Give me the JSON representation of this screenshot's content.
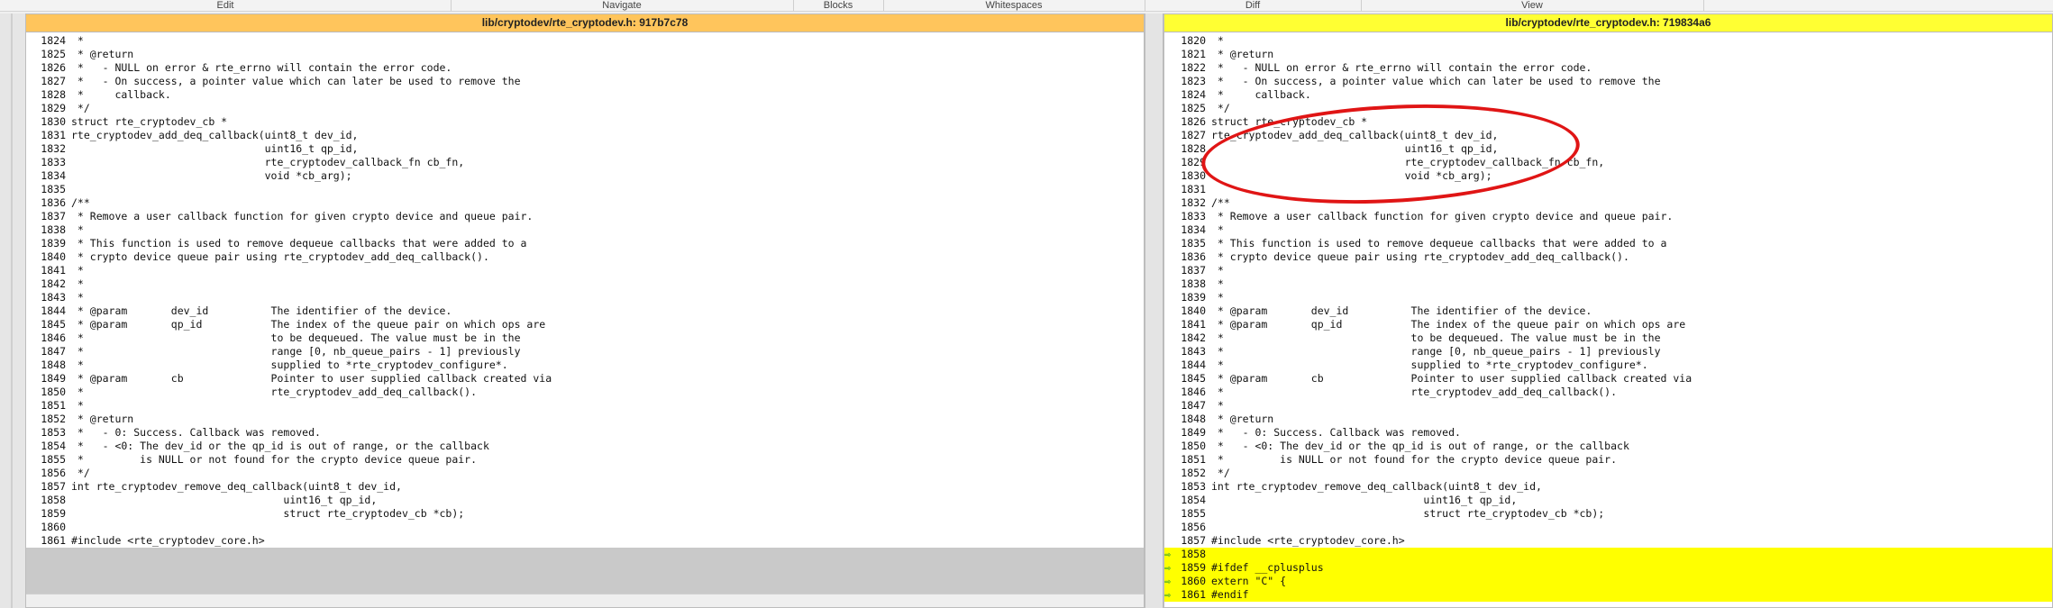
{
  "menu": [
    "Edit",
    "Navigate",
    "Blocks",
    "Whitespaces",
    "Diff",
    "View"
  ],
  "left": {
    "title": "lib/cryptodev/rte_cryptodev.h: 917b7c78",
    "lines": [
      {
        "n": "1824",
        "t": " *"
      },
      {
        "n": "1825",
        "t": " * @return"
      },
      {
        "n": "1826",
        "t": " *   - NULL on error & rte_errno will contain the error code."
      },
      {
        "n": "1827",
        "t": " *   - On success, a pointer value which can later be used to remove the"
      },
      {
        "n": "1828",
        "t": " *     callback."
      },
      {
        "n": "1829",
        "t": " */"
      },
      {
        "n": "1830",
        "t": "struct rte_cryptodev_cb *"
      },
      {
        "n": "1831",
        "t": "rte_cryptodev_add_deq_callback(uint8_t dev_id,"
      },
      {
        "n": "1832",
        "t": "\t\t\t       uint16_t qp_id,"
      },
      {
        "n": "1833",
        "t": "\t\t\t       rte_cryptodev_callback_fn cb_fn,"
      },
      {
        "n": "1834",
        "t": "\t\t\t       void *cb_arg);"
      },
      {
        "n": "1835",
        "t": ""
      },
      {
        "n": "1836",
        "t": "/**"
      },
      {
        "n": "1837",
        "t": " * Remove a user callback function for given crypto device and queue pair."
      },
      {
        "n": "1838",
        "t": " *"
      },
      {
        "n": "1839",
        "t": " * This function is used to remove dequeue callbacks that were added to a"
      },
      {
        "n": "1840",
        "t": " * crypto device queue pair using rte_cryptodev_add_deq_callback()."
      },
      {
        "n": "1841",
        "t": " *"
      },
      {
        "n": "1842",
        "t": " *"
      },
      {
        "n": "1843",
        "t": " *"
      },
      {
        "n": "1844",
        "t": " * @param\tdev_id\t\tThe identifier of the device."
      },
      {
        "n": "1845",
        "t": " * @param\tqp_id\t\tThe index of the queue pair on which ops are"
      },
      {
        "n": "1846",
        "t": " *\t\t\t\tto be dequeued. The value must be in the"
      },
      {
        "n": "1847",
        "t": " *\t\t\t\trange [0, nb_queue_pairs - 1] previously"
      },
      {
        "n": "1848",
        "t": " *\t\t\t\tsupplied to *rte_cryptodev_configure*."
      },
      {
        "n": "1849",
        "t": " * @param\tcb\t\tPointer to user supplied callback created via"
      },
      {
        "n": "1850",
        "t": " *\t\t\t\trte_cryptodev_add_deq_callback()."
      },
      {
        "n": "1851",
        "t": " *"
      },
      {
        "n": "1852",
        "t": " * @return"
      },
      {
        "n": "1853",
        "t": " *   - 0: Success. Callback was removed."
      },
      {
        "n": "1854",
        "t": " *   - <0: The dev_id or the qp_id is out of range, or the callback"
      },
      {
        "n": "1855",
        "t": " *         is NULL or not found for the crypto device queue pair."
      },
      {
        "n": "1856",
        "t": " */"
      },
      {
        "n": "1857",
        "t": "int rte_cryptodev_remove_deq_callback(uint8_t dev_id,"
      },
      {
        "n": "1858",
        "t": "\t\t\t\t  uint16_t qp_id,"
      },
      {
        "n": "1859",
        "t": "\t\t\t\t  struct rte_cryptodev_cb *cb);"
      },
      {
        "n": "1860",
        "t": ""
      },
      {
        "n": "1861",
        "t": "#include <rte_cryptodev_core.h>"
      }
    ]
  },
  "right": {
    "title": "lib/cryptodev/rte_cryptodev.h: 719834a6",
    "add_marker": "⇨",
    "lines": [
      {
        "n": "1820",
        "t": " *"
      },
      {
        "n": "1821",
        "t": " * @return"
      },
      {
        "n": "1822",
        "t": " *   - NULL on error & rte_errno will contain the error code."
      },
      {
        "n": "1823",
        "t": " *   - On success, a pointer value which can later be used to remove the"
      },
      {
        "n": "1824",
        "t": " *     callback."
      },
      {
        "n": "1825",
        "t": " */"
      },
      {
        "n": "1826",
        "t": "struct rte_cryptodev_cb *"
      },
      {
        "n": "1827",
        "t": "rte_cryptodev_add_deq_callback(uint8_t dev_id,"
      },
      {
        "n": "1828",
        "t": "\t\t\t       uint16_t qp_id,"
      },
      {
        "n": "1829",
        "t": "\t\t\t       rte_cryptodev_callback_fn cb_fn,"
      },
      {
        "n": "1830",
        "t": "\t\t\t       void *cb_arg);"
      },
      {
        "n": "1831",
        "t": ""
      },
      {
        "n": "1832",
        "t": "/**"
      },
      {
        "n": "1833",
        "t": " * Remove a user callback function for given crypto device and queue pair."
      },
      {
        "n": "1834",
        "t": " *"
      },
      {
        "n": "1835",
        "t": " * This function is used to remove dequeue callbacks that were added to a"
      },
      {
        "n": "1836",
        "t": " * crypto device queue pair using rte_cryptodev_add_deq_callback()."
      },
      {
        "n": "1837",
        "t": " *"
      },
      {
        "n": "1838",
        "t": " *"
      },
      {
        "n": "1839",
        "t": " *"
      },
      {
        "n": "1840",
        "t": " * @param\tdev_id\t\tThe identifier of the device."
      },
      {
        "n": "1841",
        "t": " * @param\tqp_id\t\tThe index of the queue pair on which ops are"
      },
      {
        "n": "1842",
        "t": " *\t\t\t\tto be dequeued. The value must be in the"
      },
      {
        "n": "1843",
        "t": " *\t\t\t\trange [0, nb_queue_pairs - 1] previously"
      },
      {
        "n": "1844",
        "t": " *\t\t\t\tsupplied to *rte_cryptodev_configure*."
      },
      {
        "n": "1845",
        "t": " * @param\tcb\t\tPointer to user supplied callback created via"
      },
      {
        "n": "1846",
        "t": " *\t\t\t\trte_cryptodev_add_deq_callback()."
      },
      {
        "n": "1847",
        "t": " *"
      },
      {
        "n": "1848",
        "t": " * @return"
      },
      {
        "n": "1849",
        "t": " *   - 0: Success. Callback was removed."
      },
      {
        "n": "1850",
        "t": " *   - <0: The dev_id or the qp_id is out of range, or the callback"
      },
      {
        "n": "1851",
        "t": " *         is NULL or not found for the crypto device queue pair."
      },
      {
        "n": "1852",
        "t": " */"
      },
      {
        "n": "1853",
        "t": "int rte_cryptodev_remove_deq_callback(uint8_t dev_id,"
      },
      {
        "n": "1854",
        "t": "\t\t\t\t  uint16_t qp_id,"
      },
      {
        "n": "1855",
        "t": "\t\t\t\t  struct rte_cryptodev_cb *cb);"
      },
      {
        "n": "1856",
        "t": ""
      },
      {
        "n": "1857",
        "t": "#include <rte_cryptodev_core.h>"
      },
      {
        "n": "1858",
        "t": "",
        "added": true
      },
      {
        "n": "1859",
        "t": "#ifdef __cplusplus",
        "added": true
      },
      {
        "n": "1860",
        "t": "extern \"C\" {",
        "added": true
      },
      {
        "n": "1861",
        "t": "#endif",
        "added": true
      }
    ]
  },
  "colors": {
    "left_header": "#ffc55c",
    "right_header": "#ffff33",
    "added_bg": "#ffff00",
    "annotation": "#e01515"
  }
}
